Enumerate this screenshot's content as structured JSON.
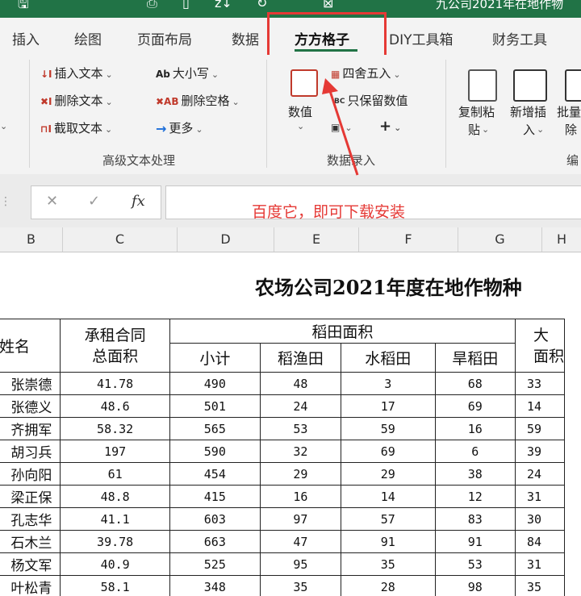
{
  "titlebar": {
    "quick_access": [
      "🖫",
      "⎙",
      "▯",
      "z↓",
      "↻",
      "⊠"
    ],
    "title": "九公司2021年在地作物"
  },
  "tabs": [
    {
      "label": "插入",
      "active": false
    },
    {
      "label": "绘图",
      "active": false
    },
    {
      "label": "页面布局",
      "active": false
    },
    {
      "label": "数据",
      "active": false
    },
    {
      "label": "方方格子",
      "active": true
    },
    {
      "label": "DIY工具箱",
      "active": false
    },
    {
      "label": "财务工具",
      "active": false
    }
  ],
  "ribbon": {
    "text_group": {
      "insert_text": "插入文本",
      "delete_text": "删除文本",
      "extract_text": "截取文本",
      "case": "大小写",
      "delete_spaces": "删除空格",
      "more": "更多",
      "label": "高级文本处理",
      "icons": {
        "insert": "↓I",
        "delete": "✖I",
        "extract": "⊓I",
        "case": "Ab",
        "spaces": "✖AB",
        "more": "→"
      }
    },
    "entry_group": {
      "value_label": "数值",
      "round": "四舍五入",
      "keep_values": "只保留数值",
      "plus": "+",
      "label": "数据录入"
    },
    "copy_paste": [
      "复制粘",
      "贴"
    ],
    "add_insert": [
      "新增插",
      "入"
    ],
    "batch": [
      "批量",
      "除"
    ],
    "edit_cut": "编"
  },
  "formula_bar": {
    "cancel": "✕",
    "confirm": "✓",
    "fx": "fx",
    "annotation": "百度它，即可下载安装"
  },
  "columns": [
    "B",
    "C",
    "D",
    "E",
    "F",
    "G",
    "H"
  ],
  "sheet": {
    "title": "农场公司2021年度在地作物种",
    "headers": {
      "name": "姓名",
      "contract_area_1": "承租合同",
      "contract_area_2": "总面积",
      "rice_area": "稻田面积",
      "subtotal": "小计",
      "rice_fish": "稻渔田",
      "paddy": "水稻田",
      "dry_rice": "旱稻田",
      "other_1": "大",
      "other_2": "面积"
    },
    "rows": [
      {
        "name": "张崇德",
        "contract": "41.78",
        "subtotal": "490",
        "rice_fish": "48",
        "paddy": "3",
        "dry": "68",
        "other": "33"
      },
      {
        "name": "张德义",
        "contract": "48.6",
        "subtotal": "501",
        "rice_fish": "24",
        "paddy": "17",
        "dry": "69",
        "other": "14"
      },
      {
        "name": "齐拥军",
        "contract": "58.32",
        "subtotal": "565",
        "rice_fish": "53",
        "paddy": "59",
        "dry": "16",
        "other": "59"
      },
      {
        "name": "胡习兵",
        "contract": "197",
        "subtotal": "590",
        "rice_fish": "32",
        "paddy": "69",
        "dry": "6",
        "other": "39"
      },
      {
        "name": "孙向阳",
        "contract": "61",
        "subtotal": "454",
        "rice_fish": "29",
        "paddy": "29",
        "dry": "38",
        "other": "24"
      },
      {
        "name": "梁正保",
        "contract": "48.8",
        "subtotal": "415",
        "rice_fish": "16",
        "paddy": "14",
        "dry": "12",
        "other": "31"
      },
      {
        "name": "孔志华",
        "contract": "41.1",
        "subtotal": "603",
        "rice_fish": "97",
        "paddy": "57",
        "dry": "83",
        "other": "30"
      },
      {
        "name": "石木兰",
        "contract": "39.78",
        "subtotal": "663",
        "rice_fish": "47",
        "paddy": "91",
        "dry": "91",
        "other": "84"
      },
      {
        "name": "杨文军",
        "contract": "40.9",
        "subtotal": "525",
        "rice_fish": "95",
        "paddy": "35",
        "dry": "53",
        "other": "31"
      },
      {
        "name": "叶松青",
        "contract": "58.1",
        "subtotal": "348",
        "rice_fish": "35",
        "paddy": "28",
        "dry": "98",
        "other": "35"
      }
    ]
  },
  "colors": {
    "brand": "#217346",
    "highlight": "#e53935"
  }
}
